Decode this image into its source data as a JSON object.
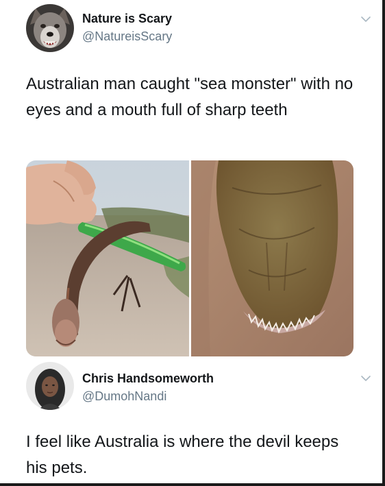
{
  "tweet1": {
    "display_name": "Nature is Scary",
    "handle": "@NatureisScary",
    "text": "Australian man caught \"sea monster\" with no eyes and a mouth full of sharp teeth",
    "avatar_icon": "wolf-avatar",
    "menu_icon": "chevron-down-icon",
    "photos": [
      {
        "icon": "eel-held-with-lure-photo"
      },
      {
        "icon": "eel-head-closeup-photo"
      }
    ]
  },
  "tweet2": {
    "display_name": "Chris Handsomeworth",
    "handle": "@DumohNandi",
    "text": "I feel like Australia is where the devil keeps his pets.",
    "avatar_icon": "person-avatar",
    "menu_icon": "chevron-down-icon"
  },
  "colors": {
    "text_primary": "#14171a",
    "text_secondary": "#657786",
    "chevron": "#aab8c2",
    "background": "#ffffff"
  }
}
